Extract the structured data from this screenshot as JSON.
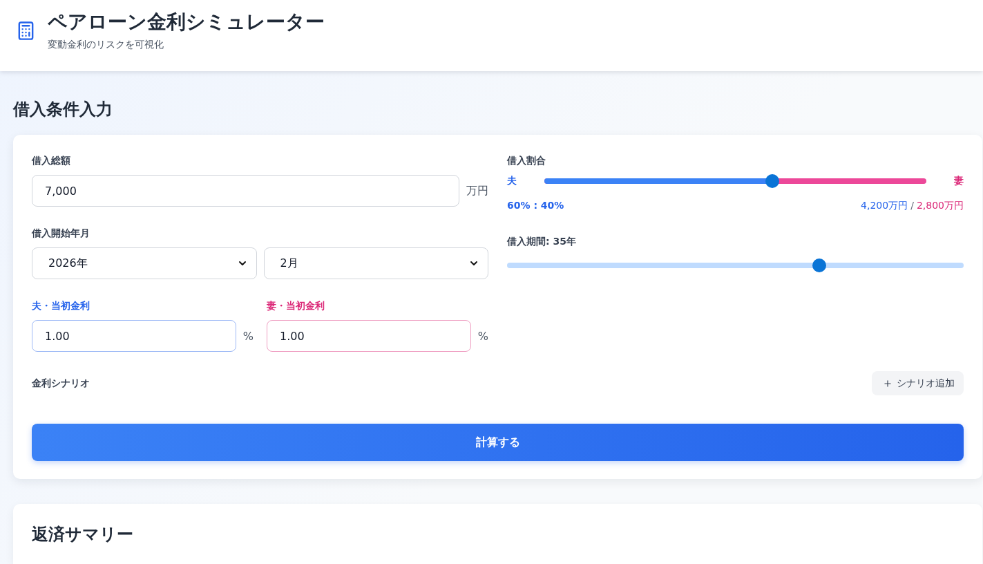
{
  "header": {
    "title": "ペアローン金利シミュレーター",
    "subtitle": "変動金利のリスクを可視化"
  },
  "input_section": {
    "heading": "借入条件入力",
    "loan_amount": {
      "label": "借入総額",
      "value": "7,000",
      "unit": "万円"
    },
    "start_date": {
      "label": "借入開始年月",
      "year": "2026年",
      "month": "2月"
    },
    "rates": [
      {
        "label": "夫・当初金利",
        "value": "1.00",
        "unit": "%",
        "color": "#2563eb"
      },
      {
        "label": "妻・当初金利",
        "value": "1.00",
        "unit": "%",
        "color": "#db2777"
      }
    ],
    "ratio": {
      "label": "借入割合",
      "left_label": "夫",
      "right_label": "妻",
      "level": 0.6,
      "percent": "60% : 40%",
      "amounts": [
        "4,200万円",
        "2,800万円"
      ],
      "separator": "/"
    },
    "term": {
      "label": "借入期間: 35年",
      "level": 0.69
    },
    "scenarios": {
      "label": "金利シナリオ",
      "add_button": "シナリオ追加"
    },
    "calculate_button": "計算する"
  },
  "summary_section": {
    "heading": "返済サマリー"
  }
}
